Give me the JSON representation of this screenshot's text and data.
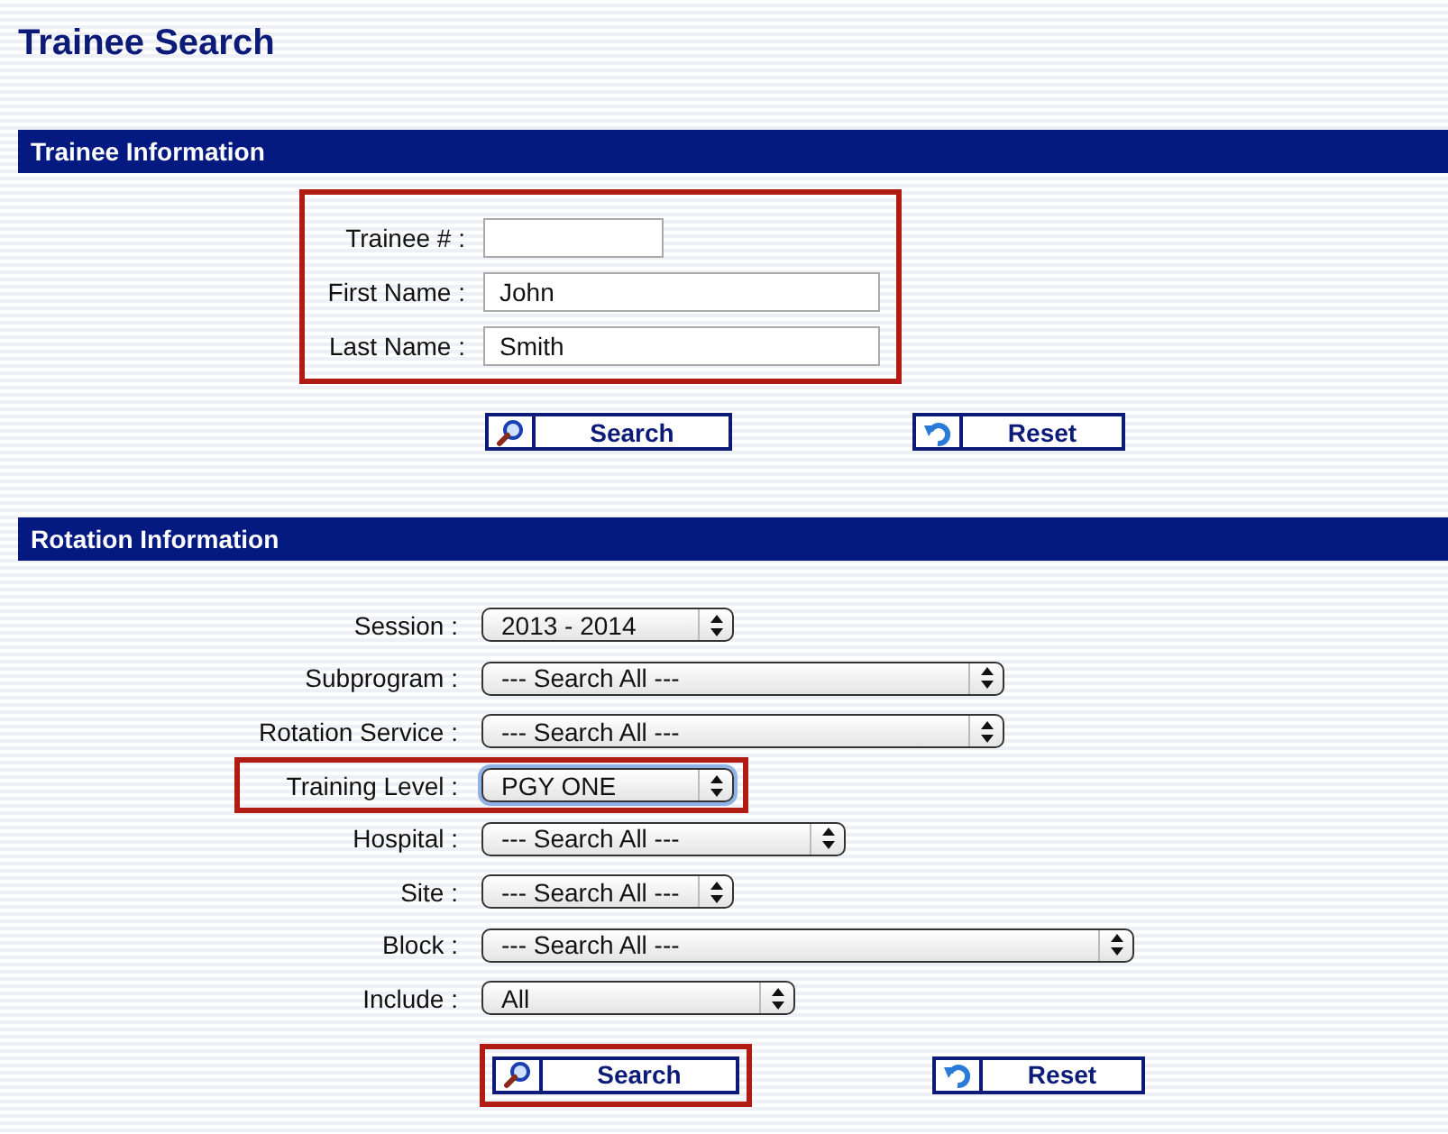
{
  "title": "Trainee Search",
  "trainee_section": {
    "heading": "Trainee Information",
    "highlighted": true,
    "fields": [
      {
        "label": "Trainee # :"
      },
      {
        "label": "First Name :",
        "value": "John"
      },
      {
        "label": "Last Name :",
        "value": "Smith"
      }
    ],
    "buttons": [
      {
        "kind": "search",
        "label": "Search",
        "highlighted": false
      },
      {
        "kind": "reset",
        "label": "Reset",
        "highlighted": false
      }
    ]
  },
  "rotation_section": {
    "heading": "Rotation Information",
    "fields": [
      {
        "label": "Session :",
        "value": "2013 - 2014",
        "highlighted": false,
        "focused": false
      },
      {
        "label": "Subprogram :",
        "value": "--- Search All ---",
        "highlighted": false,
        "focused": false
      },
      {
        "label": "Rotation Service :",
        "value": "--- Search All ---",
        "highlighted": false,
        "focused": false
      },
      {
        "label": "Training Level  :",
        "value": "PGY ONE",
        "highlighted": true,
        "focused": true
      },
      {
        "label": "Hospital :",
        "value": "--- Search All ---",
        "highlighted": false,
        "focused": false
      },
      {
        "label": "Site :",
        "value": "--- Search All ---",
        "highlighted": false,
        "focused": false
      },
      {
        "label": "Block :",
        "value": "--- Search All ---",
        "highlighted": false,
        "focused": false
      },
      {
        "label": "Include :",
        "value": "All",
        "highlighted": false,
        "focused": false
      }
    ],
    "buttons": [
      {
        "kind": "search",
        "label": "Search",
        "highlighted": true
      },
      {
        "kind": "reset",
        "label": "Reset",
        "highlighted": false
      }
    ]
  }
}
